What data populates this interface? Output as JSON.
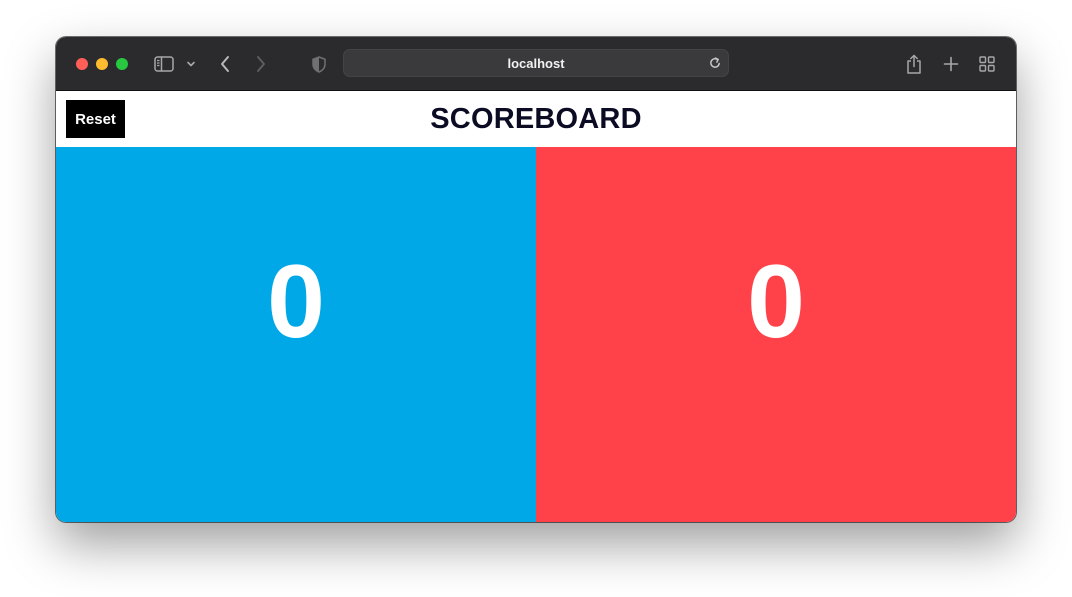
{
  "browser": {
    "url": "localhost",
    "traffic_colors": {
      "close": "#ff5f57",
      "minimize": "#febc2e",
      "maximize": "#28c840"
    },
    "toolbar_icons": [
      "sidebar-icon",
      "chevron-down-icon",
      "back-icon",
      "forward-icon",
      "shield-icon",
      "reload-icon",
      "share-icon",
      "plus-icon",
      "tab-overview-icon"
    ]
  },
  "app": {
    "title": "SCOREBOARD",
    "reset_label": "Reset",
    "teams": [
      {
        "score": "0",
        "color": "#00a8e8"
      },
      {
        "score": "0",
        "color": "#ff4249"
      }
    ]
  }
}
